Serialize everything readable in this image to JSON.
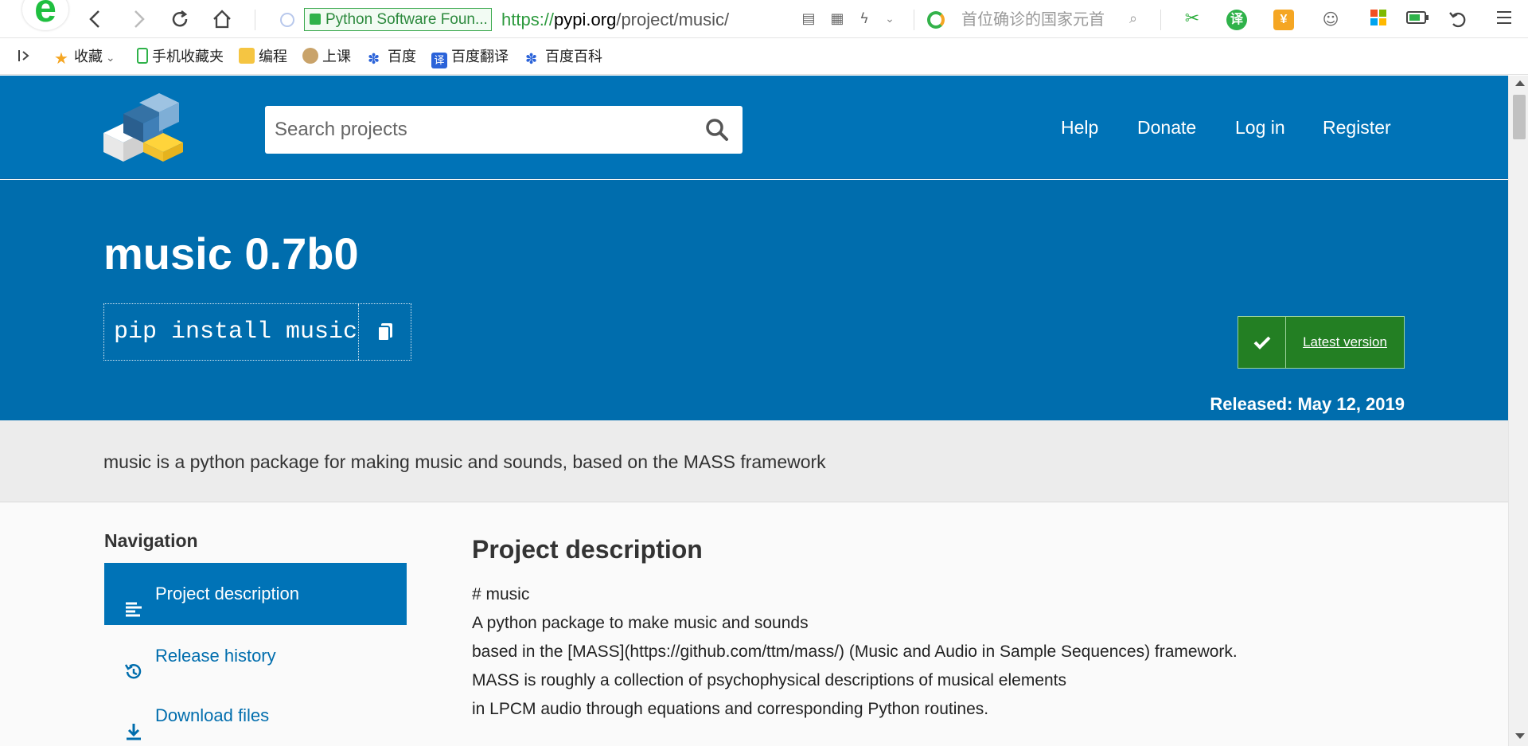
{
  "browser": {
    "security_label": "Python Software Foun...",
    "url_scheme": "https://",
    "url_host": "pypi.org",
    "url_path": "/project/music/",
    "search_hint": "首位确诊的国家元首",
    "bookmarks": [
      {
        "label": "收藏",
        "icon": "star-icon"
      },
      {
        "label": "手机收藏夹",
        "icon": "phone-icon"
      },
      {
        "label": "编程",
        "icon": "folder-icon"
      },
      {
        "label": "上课",
        "icon": "bird-icon"
      },
      {
        "label": "百度",
        "icon": "baidu-paw-icon"
      },
      {
        "label": "百度翻译",
        "icon": "translate-icon"
      },
      {
        "label": "百度百科",
        "icon": "baidu-paw-icon"
      }
    ]
  },
  "header": {
    "search_placeholder": "Search projects",
    "nav": [
      "Help",
      "Donate",
      "Log in",
      "Register"
    ]
  },
  "package": {
    "title": "music 0.7b0",
    "pip_command": "pip install music",
    "latest_label": "Latest version",
    "released": "Released: May 12, 2019"
  },
  "summary": "music is a python package for making music and sounds, based on the MASS framework",
  "sidebar": {
    "title": "Navigation",
    "items": [
      {
        "label": "Project description",
        "icon": "align-left-icon",
        "active": true
      },
      {
        "label": "Release history",
        "icon": "history-icon",
        "active": false
      },
      {
        "label": "Download files",
        "icon": "download-icon",
        "active": false
      }
    ]
  },
  "description": {
    "heading": "Project description",
    "lines": [
      "# music",
      "A python package to make music and sounds",
      "based in the [MASS](https://github.com/ttm/mass/) (Music and Audio in Sample Sequences) framework.",
      "MASS is roughly a collection of psychophysical descriptions of musical elements",
      "in LPCM audio through equations and corresponding Python routines."
    ]
  },
  "colors": {
    "header_blue": "#0073b7",
    "banner_blue": "#006dad",
    "latest_green": "#237f23",
    "summary_gray": "#ececec"
  }
}
